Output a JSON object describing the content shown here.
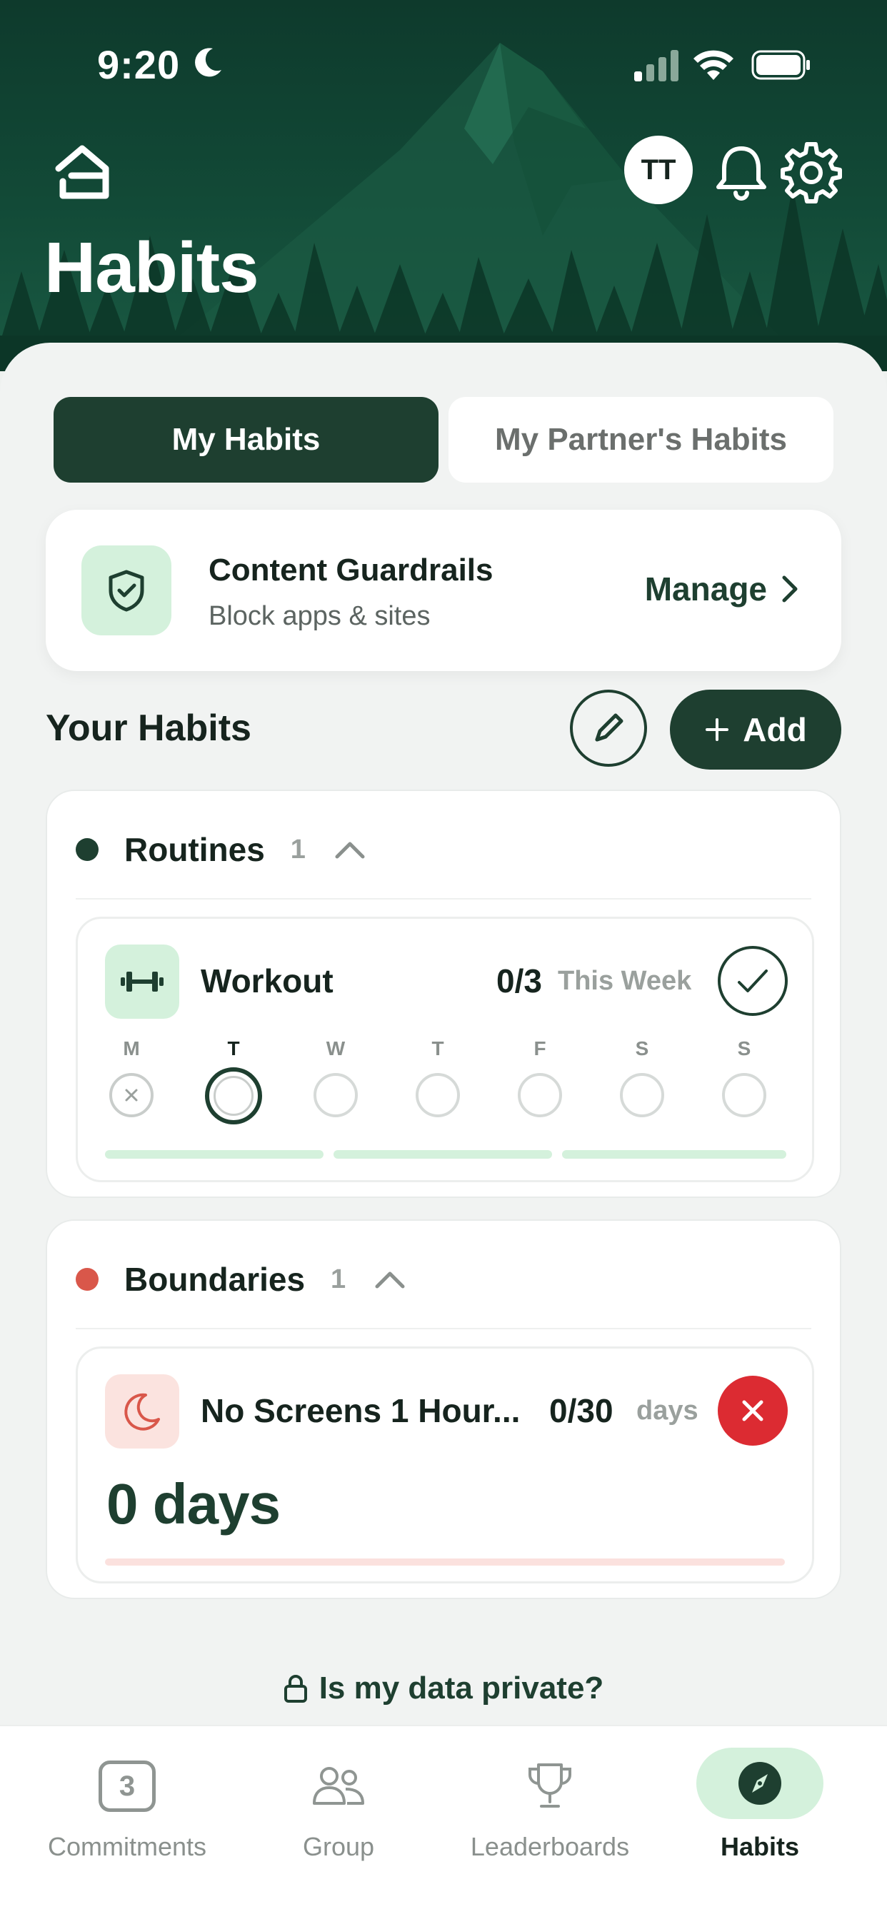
{
  "status_bar": {
    "time": "9:20"
  },
  "header": {
    "title": "Habits",
    "avatar_initials": "TT"
  },
  "tabs": [
    {
      "label": "My Habits",
      "active": true
    },
    {
      "label": "My Partner's Habits",
      "active": false
    }
  ],
  "guardrails": {
    "title": "Content Guardrails",
    "subtitle": "Block apps & sites",
    "action": "Manage"
  },
  "your_habits": {
    "title": "Your Habits",
    "add_label": "Add"
  },
  "groups": [
    {
      "name": "Routines",
      "count": "1",
      "color": "#1e3f30",
      "habit": {
        "name": "Workout",
        "progress": "0/3",
        "unit": "This Week",
        "days": [
          "M",
          "T",
          "W",
          "T",
          "F",
          "S",
          "S"
        ]
      }
    },
    {
      "name": "Boundaries",
      "count": "1",
      "color": "#d9574a",
      "habit": {
        "name": "No Screens 1 Hour...",
        "progress": "0/30",
        "unit": "days",
        "streak": "0 days"
      }
    }
  ],
  "privacy_link": "Is my data private?",
  "nav": [
    {
      "label": "Commitments",
      "badge": "3"
    },
    {
      "label": "Group"
    },
    {
      "label": "Leaderboards"
    },
    {
      "label": "Habits",
      "active": true
    }
  ],
  "colors": {
    "brand_dark": "#1e3f30",
    "accent_light": "#d4f1dc",
    "danger": "#dc2b32",
    "boundary_dot": "#d9574a"
  }
}
